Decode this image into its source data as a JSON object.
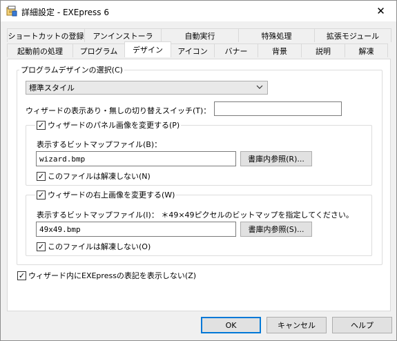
{
  "window": {
    "title": "詳細設定 - EXEpress 6",
    "close": "✕"
  },
  "tabs": {
    "row_top": [
      "ショートカットの登録",
      "アンインストーラ",
      "自動実行",
      "特殊処理",
      "拡張モジュール"
    ],
    "row_bottom": [
      "起動前の処理",
      "プログラム",
      "デザイン",
      "アイコン",
      "バナー",
      "背景",
      "説明",
      "解凍"
    ],
    "active": "デザイン"
  },
  "design": {
    "program_design_label": "プログラムデザインの選択(C)",
    "style_value": "標準スタイル",
    "toggle_switch_label": "ウィザードの表示あり・無しの切り替えスイッチ(T)：",
    "toggle_switch_value": "",
    "panel_image": {
      "checkbox_label": "ウィザードのパネル画像を変更する(P)",
      "checked": true,
      "file_label": "表示するビットマップファイル(B)：",
      "file_value": "wizard.bmp",
      "browse_label": "書庫内参照(R)...",
      "no_extract_label": "このファイルは解凍しない(N)",
      "no_extract_checked": true
    },
    "corner_image": {
      "checkbox_label": "ウィザードの右上画像を変更する(W)",
      "checked": true,
      "file_label": "表示するビットマップファイル(I)：  ＊49×49ピクセルのビットマップを指定してください。",
      "file_value": "49x49.bmp",
      "browse_label": "書庫内参照(S)...",
      "no_extract_label": "このファイルは解凍しない(O)",
      "no_extract_checked": true
    },
    "hide_branding_label": "ウィザード内にEXEpressの表記を表示しない(Z)",
    "hide_branding_checked": true
  },
  "footer": {
    "ok": "OK",
    "cancel": "キャンセル",
    "help": "ヘルプ"
  },
  "colors": {
    "accent": "#0078d7",
    "panel_bg": "#ffffff",
    "window_bg": "#f0f0f0"
  },
  "icons": {
    "app": "installer-box-icon",
    "dropdown": "chevron-down-icon",
    "check": "checkmark-icon"
  }
}
